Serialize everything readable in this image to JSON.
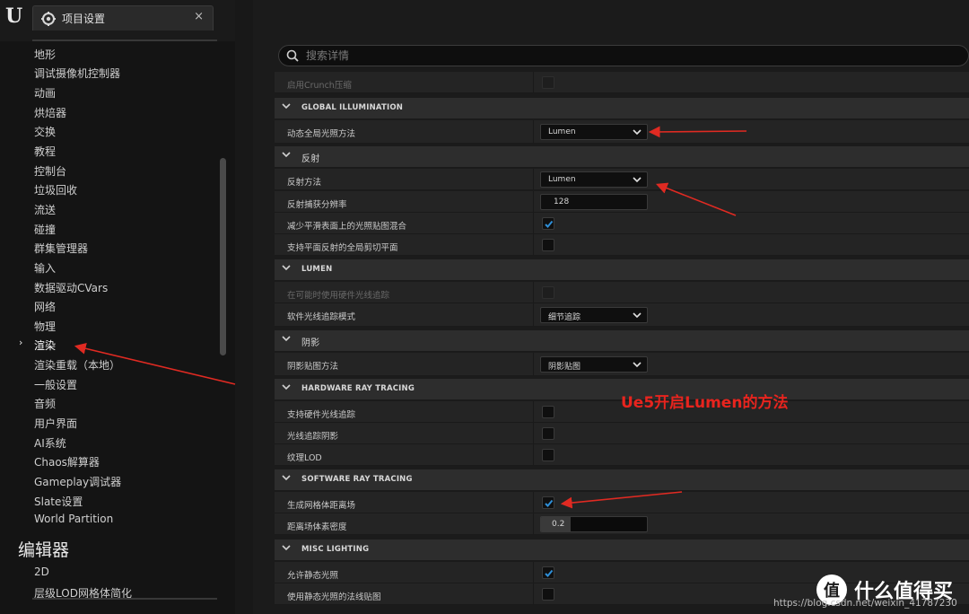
{
  "window": {
    "logo_text": "U",
    "tab_title": "项目设置",
    "tab_close": "×"
  },
  "sidebar": {
    "items": [
      {
        "label": "地形"
      },
      {
        "label": "调试摄像机控制器"
      },
      {
        "label": "动画"
      },
      {
        "label": "烘焙器"
      },
      {
        "label": "交换"
      },
      {
        "label": "教程"
      },
      {
        "label": "控制台"
      },
      {
        "label": "垃圾回收"
      },
      {
        "label": "流送"
      },
      {
        "label": "碰撞"
      },
      {
        "label": "群集管理器"
      },
      {
        "label": "输入"
      },
      {
        "label": "数据驱动CVars"
      },
      {
        "label": "网络"
      },
      {
        "label": "物理"
      },
      {
        "label": "渲染",
        "selected": true
      },
      {
        "label": "渲染重载（本地）"
      },
      {
        "label": "一般设置"
      },
      {
        "label": "音频"
      },
      {
        "label": "用户界面"
      },
      {
        "label": "AI系统"
      },
      {
        "label": "Chaos解算器"
      },
      {
        "label": "Gameplay调试器"
      },
      {
        "label": "Slate设置"
      },
      {
        "label": "World Partition"
      }
    ],
    "selected_arrow": "›",
    "editor_header": "编辑器",
    "editor_items": [
      {
        "label": "2D"
      },
      {
        "label": "层级LOD网格体简化"
      }
    ]
  },
  "search": {
    "placeholder": "搜索详情"
  },
  "details": {
    "top_row": {
      "label": "启用Crunch压缩",
      "checked": false
    },
    "sections": {
      "gi": {
        "title": "GLOBAL ILLUMINATION",
        "rows": {
          "method": {
            "label": "动态全局光照方法",
            "value": "Lumen"
          }
        }
      },
      "reflection": {
        "title": "反射",
        "rows": {
          "method": {
            "label": "反射方法",
            "value": "Lumen"
          },
          "capture": {
            "label": "反射捕获分辨率",
            "value": "128"
          },
          "reduce": {
            "label": "减少平滑表面上的光照贴图混合",
            "checked": true
          },
          "planar": {
            "label": "支持平面反射的全局剪切平面",
            "checked": false
          }
        }
      },
      "lumen": {
        "title": "LUMEN",
        "rows": {
          "hw": {
            "label": "在可能时使用硬件光线追踪",
            "checked": false
          },
          "sw_mode": {
            "label": "软件光线追踪模式",
            "value": "细节追踪"
          }
        }
      },
      "shadows": {
        "title": "阴影",
        "rows": {
          "method": {
            "label": "阴影贴图方法",
            "value": "阴影贴图"
          }
        }
      },
      "hwrt": {
        "title": "HARDWARE RAY TRACING",
        "rows": {
          "support": {
            "label": "支持硬件光线追踪",
            "checked": false
          },
          "shadows": {
            "label": "光线追踪阴影",
            "checked": false
          },
          "lod": {
            "label": "纹理LOD",
            "checked": false
          }
        }
      },
      "swrt": {
        "title": "SOFTWARE RAY TRACING",
        "rows": {
          "gen_df": {
            "label": "生成网格体距离场",
            "checked": true
          },
          "voxel": {
            "label": "距离场体素密度",
            "value": "0.2",
            "fraction": 0.28
          }
        }
      },
      "misc": {
        "title": "MISC LIGHTING",
        "rows": {
          "static": {
            "label": "允许静态光照",
            "checked": true
          },
          "normal": {
            "label": "使用静态光照的法线贴图",
            "checked": false
          }
        }
      }
    }
  },
  "annotation": {
    "text": "Ue5开启Lumen的方法",
    "color": "#e8241e"
  },
  "watermark": {
    "url": "https://blog.csdn.net/weixin_41787230",
    "brand": "什么值得买",
    "brand_logo": "值"
  },
  "colors": {
    "accent_check": "#2f8fd8",
    "arrow_red": "#e02a22"
  }
}
